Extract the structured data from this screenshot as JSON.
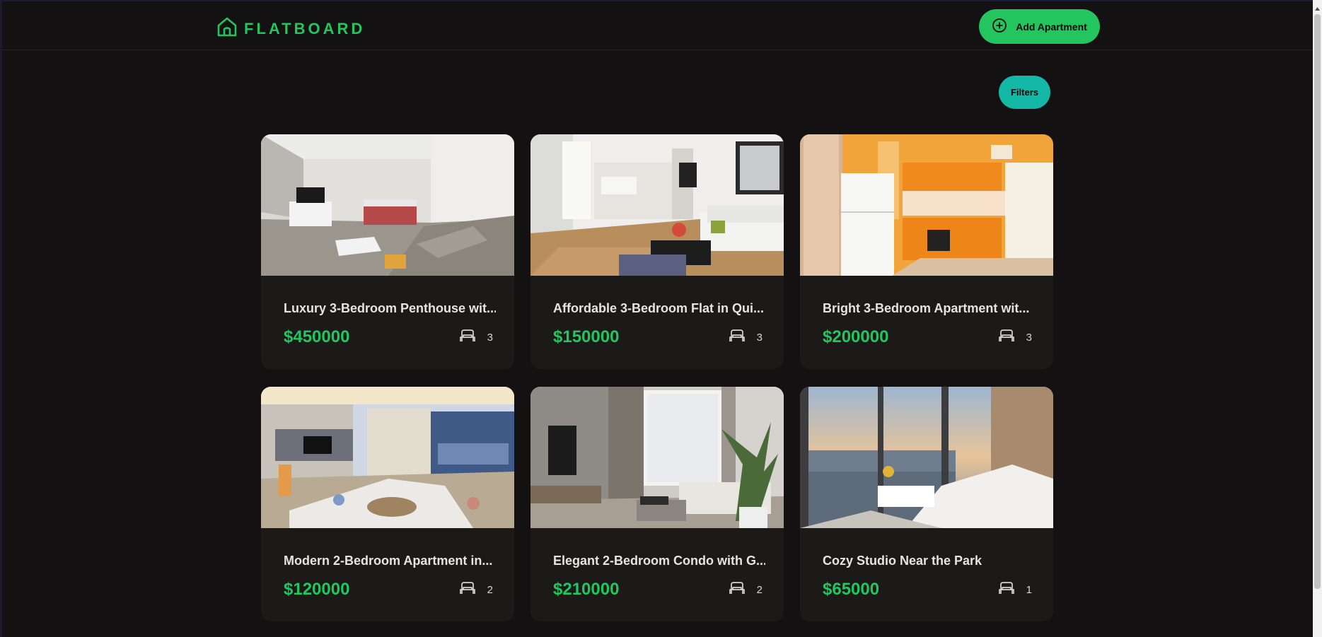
{
  "app": {
    "logo_text": "FLATBOARD",
    "brand_color": "#22c55e",
    "logo_icon": "house-icon"
  },
  "header": {
    "add_button_label": "Add Apartment",
    "add_button_icon": "plus-circle-icon"
  },
  "toolbar": {
    "filters_label": "Filters",
    "filters_color": "#14b8a6"
  },
  "listings": [
    {
      "title": "Luxury 3-Bedroom Penthouse wit...",
      "price": "$450000",
      "bedrooms": "3",
      "image": "living-room-with-beige-sofa-photo"
    },
    {
      "title": "Affordable 3-Bedroom Flat in Qui...",
      "price": "$150000",
      "bedrooms": "3",
      "image": "white-living-room-with-dining-area-photo"
    },
    {
      "title": "Bright 3-Bedroom Apartment wit...",
      "price": "$200000",
      "bedrooms": "3",
      "image": "orange-kitchen-photo"
    },
    {
      "title": "Modern 2-Bedroom Apartment in...",
      "price": "$120000",
      "bedrooms": "2",
      "image": "modern-lounge-at-dusk-photo"
    },
    {
      "title": "Elegant 2-Bedroom Condo with G...",
      "price": "$210000",
      "bedrooms": "2",
      "image": "minimal-living-room-with-plant-photo"
    },
    {
      "title": "Cozy Studio Near the Park",
      "price": "$65000",
      "bedrooms": "1",
      "image": "city-view-living-room-photo"
    }
  ]
}
